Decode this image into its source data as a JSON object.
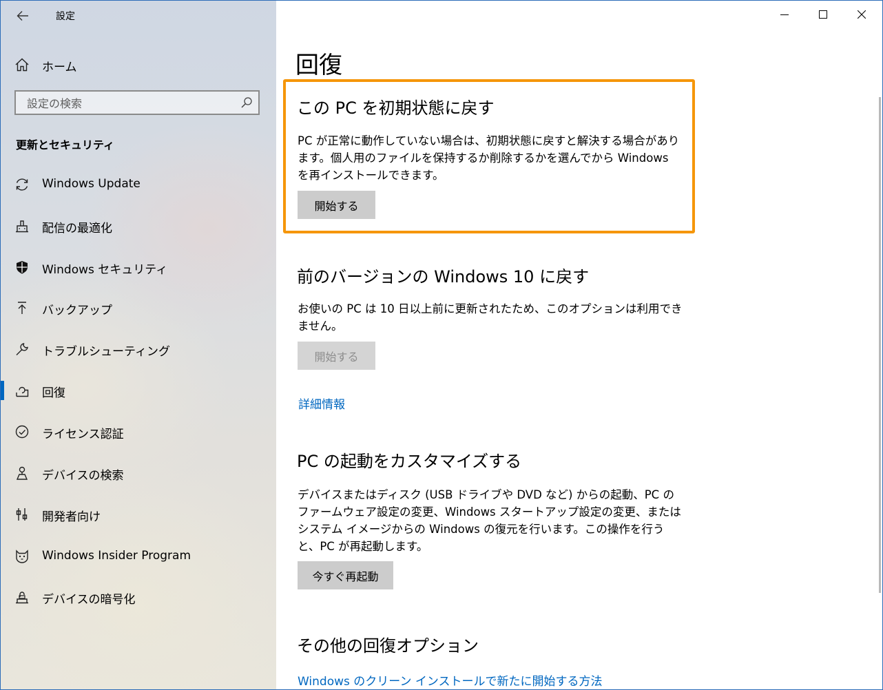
{
  "window": {
    "title": "設定"
  },
  "sidebar": {
    "home_label": "ホーム",
    "search_placeholder": "設定の検索",
    "section_title": "更新とセキュリティ",
    "items": [
      {
        "label": "Windows Update",
        "icon": "sync-icon"
      },
      {
        "label": "配信の最適化",
        "icon": "delivery-optimization-icon"
      },
      {
        "label": "Windows セキュリティ",
        "icon": "shield-icon"
      },
      {
        "label": "バックアップ",
        "icon": "backup-icon"
      },
      {
        "label": "トラブルシューティング",
        "icon": "wrench-icon"
      },
      {
        "label": "回復",
        "icon": "recovery-icon",
        "selected": true
      },
      {
        "label": "ライセンス認証",
        "icon": "check-circle-icon"
      },
      {
        "label": "デバイスの検索",
        "icon": "find-device-icon"
      },
      {
        "label": "開発者向け",
        "icon": "developer-icon"
      },
      {
        "label": "Windows Insider Program",
        "icon": "insider-cat-icon"
      },
      {
        "label": "デバイスの暗号化",
        "icon": "encryption-icon"
      }
    ]
  },
  "main": {
    "title": "回復",
    "reset": {
      "heading": "この PC を初期状態に戻す",
      "description": "PC が正常に動作していない場合は、初期状態に戻すと解決する場合があります。個人用のファイルを保持するか削除するかを選んでから Windows を再インストールできます。",
      "button": "開始する"
    },
    "go_back": {
      "heading": "前のバージョンの Windows 10 に戻す",
      "description": "お使いの PC は 10 日以上前に更新されたため、このオプションは利用できません。",
      "button": "開始する",
      "link": "詳細情報"
    },
    "advanced": {
      "heading": "PC の起動をカスタマイズする",
      "description": "デバイスまたはディスク (USB ドライブや DVD など) からの起動、PC のファームウェア設定の変更、Windows スタートアップ設定の変更、またはシステム イメージからの Windows の復元を行います。この操作を行うと、PC が再起動します。",
      "button": "今すぐ再起動"
    },
    "more": {
      "heading": "その他の回復オプション",
      "link": "Windows のクリーン インストールで新たに開始する方法"
    }
  },
  "colors": {
    "accent": "#0067c0",
    "highlight_border": "#f5960a",
    "button_bg": "#cccccc"
  }
}
